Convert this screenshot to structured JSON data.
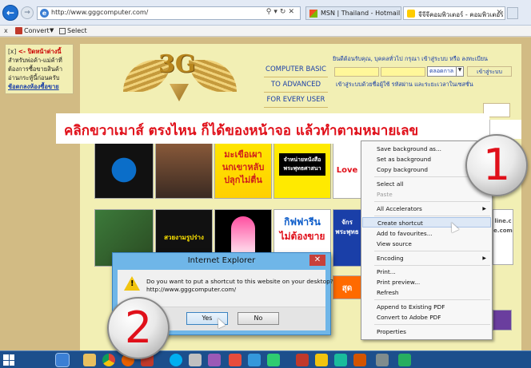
{
  "browser": {
    "url": "http://www.gggcomputer.com/",
    "tabs": [
      {
        "label": "MSN | Thailand - Hotmail, Mes..."
      },
      {
        "label": "จีจีจีคอมพิวเตอร์ - คอมพิวเตอร์ ร..."
      }
    ]
  },
  "command_bar": {
    "close": "x",
    "convert": "Convert",
    "select": "Select"
  },
  "sidebar": {
    "close_x": "[x]",
    "close_link": "<- ปิดหน้าต่างนี้",
    "body": "สำหรับพ่อค้า-แม่ค้าที่ต้องการซื้อขายสินค้า อ่านกระทู้นี้ก่อนครับ",
    "shop_link": "ช้อตกลงห้องซื้อขาย"
  },
  "logo": {
    "text": "3G"
  },
  "tagline": [
    "COMPUTER BASIC",
    "TO ADVANCED",
    "FOR EVERY USER"
  ],
  "login": {
    "welcome": "ยินดีต้อนรับคุณ, บุคคลทั่วไป กรุณา เข้าสู่ระบบ หรือ ลงทะเบียน",
    "duration": "ตลอดกาล",
    "button": "เข้าสู่ระบบ",
    "hint": "เข้าสู่ระบบด้วยชื่อผู้ใช้ รหัสผ่าน และระยะเวลาในเซสชั่น"
  },
  "instruction": "คลิกขวาเมาส์ ตรงไหน ก็ได้ของหน้าจอ แล้วทำตามหมายเลข",
  "ads": {
    "ad3": "มะเขือเผา นกเขาหลับ ปลุกไม่ตื่น",
    "ad4": "จำหน่ายหนังสือ พระพุทธศาสนา",
    "ad5": "Love",
    "ad7": "สวยงามรูปร่าง",
    "ad9_line1": "กิฟฟารีน",
    "ad9_line2": "ไม่ต้องขาย",
    "ad10": "จักรพระพุทธ",
    "ad11": "สุด",
    "right1": "line.c e.com"
  },
  "context_menu": {
    "items": [
      {
        "label": "Save background as...",
        "disabled": false,
        "sub": false
      },
      {
        "label": "Set as background",
        "disabled": false,
        "sub": false
      },
      {
        "label": "Copy background",
        "disabled": false,
        "sub": false
      },
      {
        "label": "Select all",
        "disabled": false,
        "sub": false
      },
      {
        "label": "Paste",
        "disabled": true,
        "sub": false
      },
      {
        "label": "All Accelerators",
        "disabled": false,
        "sub": true
      },
      {
        "label": "Create shortcut",
        "disabled": false,
        "sub": false,
        "highlight": true
      },
      {
        "label": "Add to favourites...",
        "disabled": false,
        "sub": false
      },
      {
        "label": "View source",
        "disabled": false,
        "sub": false
      },
      {
        "label": "Encoding",
        "disabled": false,
        "sub": true
      },
      {
        "label": "Print...",
        "disabled": false,
        "sub": false
      },
      {
        "label": "Print preview...",
        "disabled": false,
        "sub": false
      },
      {
        "label": "Refresh",
        "disabled": false,
        "sub": false
      },
      {
        "label": "Append to Existing PDF",
        "disabled": false,
        "sub": false
      },
      {
        "label": "Convert to Adobe PDF",
        "disabled": false,
        "sub": false
      },
      {
        "label": "Properties",
        "disabled": false,
        "sub": false
      }
    ],
    "submenu_arrow": "▶"
  },
  "dialog": {
    "title": "Internet Explorer",
    "close": "✕",
    "message": "Do you want to put a shortcut to this website on your desktop?",
    "url": "http://www.gggcomputer.com/",
    "yes": "Yes",
    "no": "No",
    "warn_glyph": "!"
  },
  "steps": {
    "one": "1",
    "two": "2"
  }
}
